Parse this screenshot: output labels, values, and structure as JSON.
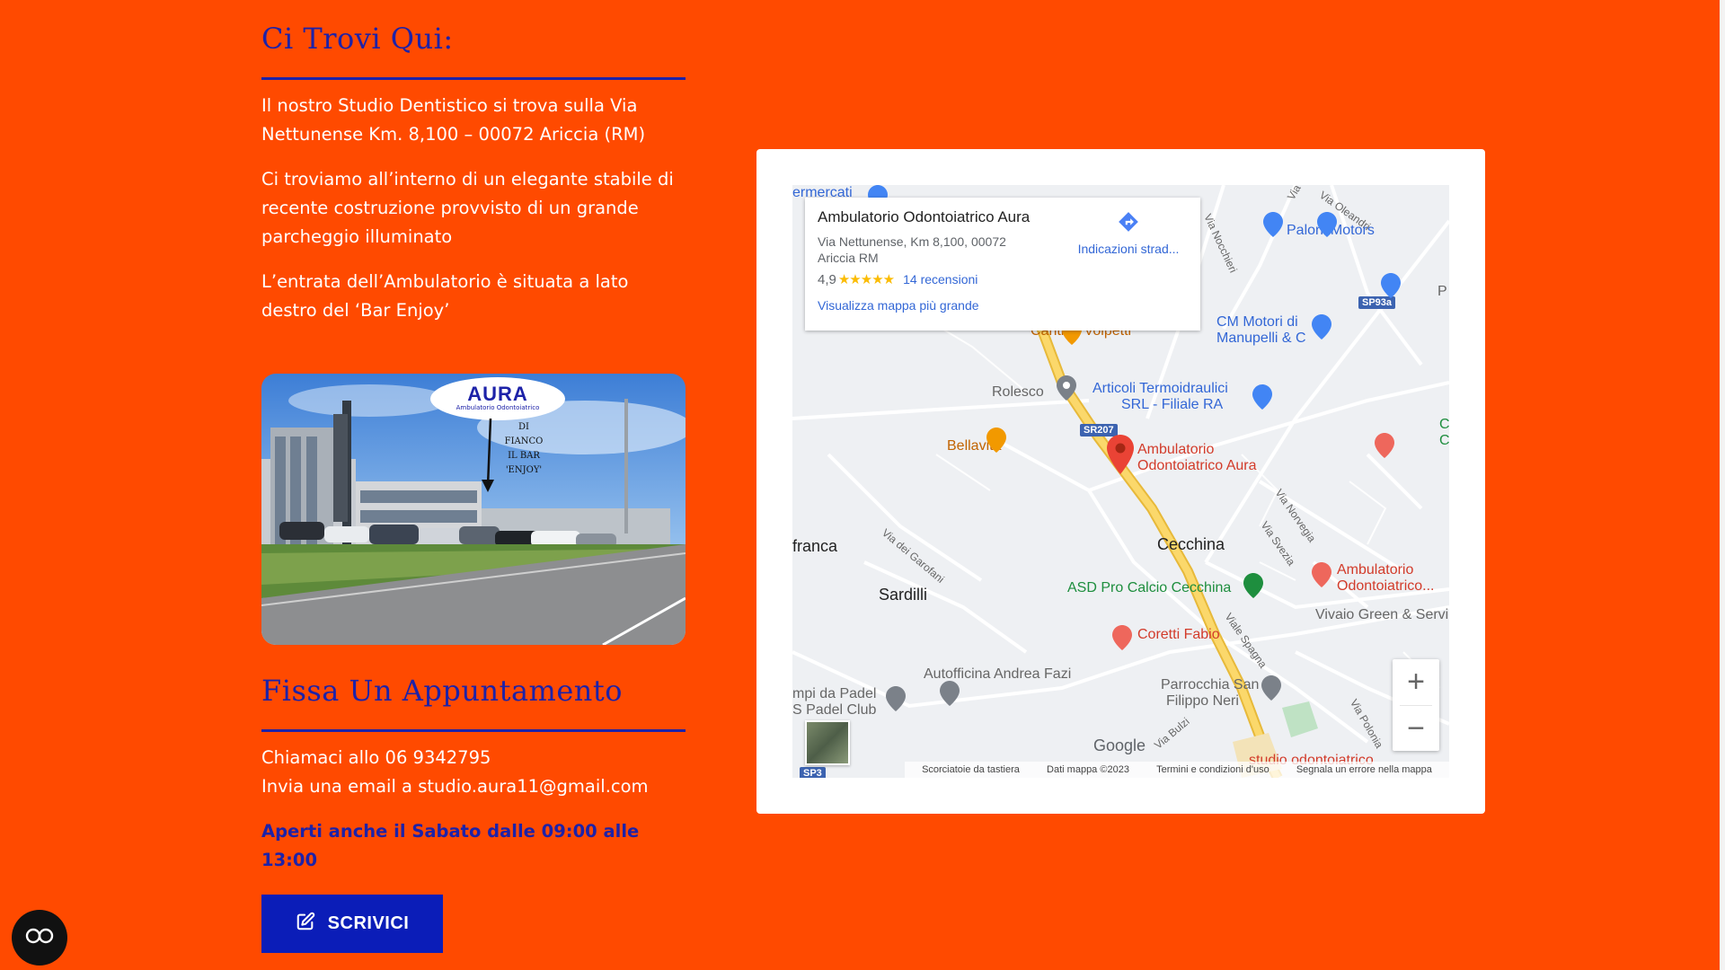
{
  "location": {
    "title": "Ci Trovi Qui:",
    "paragraphs": [
      "Il nostro Studio Dentistico si trova sulla Via Nettunense Km. 8,100 – 00072 Ariccia (RM)",
      "Ci troviamo all’interno di un elegante stabile di recente costruzione provvisto di un grande parcheggio illuminato",
      "L’entrata dell’Ambulatorio è situata a lato destro del ‘Bar Enjoy’"
    ]
  },
  "photo": {
    "logo_text": "AURA",
    "logo_subtitle": "Ambulatorio Odontoiatrico",
    "annotation": [
      "DI",
      "FIANCO",
      "IL BAR",
      "'ENJOY'"
    ]
  },
  "appointment": {
    "title": "Fissa Un Appuntamento",
    "phone_line": "Chiamaci allo 06 9342795",
    "email_line": "Invia una email a studio.aura11@gmail.com",
    "hours": "Aperti anche il Sabato dalle 09:00 alle 13:00"
  },
  "cta": {
    "label": "SCRIVICI",
    "icon": "edit-icon"
  },
  "accessibility": {
    "icon": "accessibility-icon"
  },
  "map": {
    "info_card": {
      "title": "Ambulatorio Odontoiatrico Aura",
      "address": "Via Nettunense, Km 8,100, 00072 Ariccia RM",
      "rating": "4,9",
      "stars": "★★★★★",
      "reviews": "14 recensioni",
      "larger_map": "Visualizza mappa più grande",
      "directions": "Indicazioni strad..."
    },
    "labels": {
      "paloni": "Paloni Motors",
      "cm_motori": "CM Motori di",
      "cm_motori2": "Manupelli & C",
      "cantine": "Cantine Volpetti",
      "rolesco": "Rolesco",
      "articoli": "Articoli Termoidraulici",
      "articoli2": "SRL - Filiale RA",
      "bellavita": "Bellavita",
      "ambulatorio": "Ambulatorio",
      "ambulatorio2": "Odontoiatrico Aura",
      "franca": "franca",
      "cecchina": "Cecchina",
      "sardilli": "Sardilli",
      "asd": "ASD Pro Calcio Cecchina",
      "amb2": "Ambulatorio",
      "amb2b": "Odontoiatrico...",
      "vivaio": "Vivaio Green & Service",
      "coretti": "Coretti Fabio",
      "autofficina": "Autofficina Andrea Fazi",
      "padel": "mpi da Padel",
      "padel2": "S Padel Club",
      "parrocchia": "Parrocchia San",
      "parrocchia2": "Filippo Neri",
      "studio": "studio odontoiatrico",
      "ermercati": "ermercati",
      "via_susini": "Via Susini",
      "via_oleandri": "Via Oleandri",
      "via_nocchieri": "Via Nocchieri",
      "via_garofani": "Via dei Garofani",
      "via_norvegia": "Via Norvegia",
      "via_svezia": "Via Svezia",
      "viale_spagna": "Viale Spagna",
      "via_polonia": "Via Polonia",
      "via_bulzi": "Via Bulzi",
      "right_p": "P",
      "right_c": "C",
      "right_c2": "C",
      "sp93a": "SP93a",
      "sr207": "SR207",
      "sp3": "SP3"
    },
    "google": "Google",
    "attribution": [
      "Scorciatoie da tastiera",
      "Dati mappa ©2023",
      "Termini e condizioni d'uso",
      "Segnala un errore nella mappa"
    ],
    "zoom_in": "+",
    "zoom_out": "−",
    "colors": {
      "primary_pin": "#ea4335",
      "road": "#f6c543",
      "water": "#aadaff"
    }
  }
}
